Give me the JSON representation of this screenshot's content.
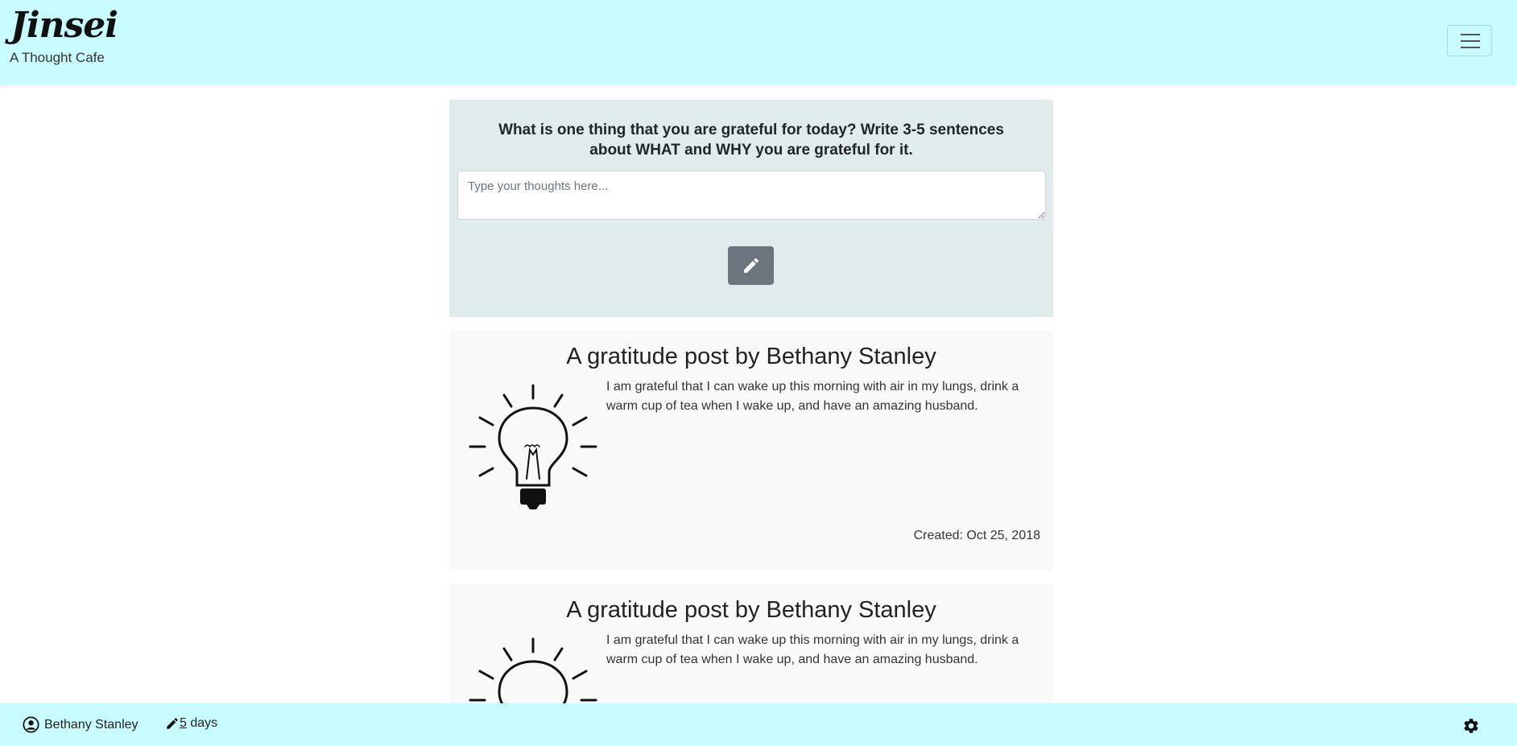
{
  "header": {
    "brand": "Jinsei",
    "tagline": "A Thought Cafe",
    "menu_icon": "hamburger-icon"
  },
  "prompt": {
    "question": "What is one thing that you are grateful for today? Write 3-5 sentences about WHAT and WHY you are grateful for it.",
    "placeholder": "Type your thoughts here...",
    "submit_icon": "pencil-icon"
  },
  "posts": [
    {
      "title": "A gratitude post by Bethany Stanley",
      "body": "I am grateful that I can wake up this morning with air in my lungs, drink a warm cup of tea when I wake up, and have an amazing husband.",
      "created": "Created: Oct 25, 2018",
      "icon": "lightbulb-icon"
    },
    {
      "title": "A gratitude post by Bethany Stanley",
      "body": "I am grateful that I can wake up this morning with air in my lungs, drink a warm cup of tea when I wake up, and have an amazing husband.",
      "icon": "lightbulb-icon"
    }
  ],
  "footer": {
    "username": "Bethany Stanley",
    "streak_count": "5",
    "streak_unit": " days",
    "user_icon": "user-circle-icon",
    "streak_icon": "pencil-icon",
    "settings_icon": "gear-icon"
  },
  "colors": {
    "header_bg": "#c9fcfe",
    "prompt_bg": "#e0ecec",
    "post_bg": "#f8f9fa",
    "button_bg": "#6c757d"
  }
}
